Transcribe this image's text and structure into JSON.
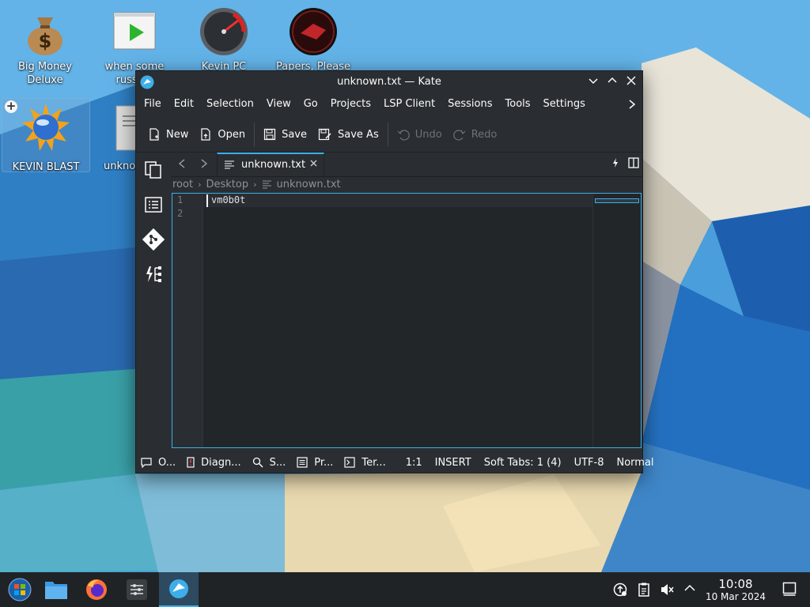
{
  "desktop": {
    "icons": [
      {
        "label": "Big Money Deluxe"
      },
      {
        "label": "when some russian"
      },
      {
        "label": "Kevin PC"
      },
      {
        "label": "Papers, Please"
      },
      {
        "label": "KEVIN BLAST"
      },
      {
        "label": "unkno"
      }
    ]
  },
  "window": {
    "title": "unknown.txt — Kate",
    "menu": [
      "File",
      "Edit",
      "Selection",
      "View",
      "Go",
      "Projects",
      "LSP Client",
      "Sessions",
      "Tools",
      "Settings"
    ],
    "toolbar": {
      "new": "New",
      "open": "Open",
      "save": "Save",
      "save_as": "Save As",
      "undo": "Undo",
      "redo": "Redo"
    },
    "tab": {
      "label": "unknown.txt"
    },
    "breadcrumb": [
      "root",
      "Desktop",
      "unknown.txt"
    ],
    "editor": {
      "line_numbers": [
        "1",
        "2"
      ],
      "lines": [
        "vm0b0t",
        ""
      ]
    },
    "statusbar": {
      "output": "O...",
      "diagnostics": "Diagn...",
      "search": "S...",
      "projects": "Pr...",
      "terminal": "Ter...",
      "position": "1:1",
      "mode": "INSERT",
      "tabs": "Soft Tabs: 1 (4)",
      "encoding": "UTF-8",
      "highlight": "Normal"
    }
  },
  "taskbar": {
    "time": "10:08",
    "date": "10 Mar 2024"
  },
  "colors": {
    "accent": "#3daee9",
    "window_bg": "#2a2e32",
    "editor_bg": "#232629",
    "taskbar_bg": "#1f2326"
  }
}
